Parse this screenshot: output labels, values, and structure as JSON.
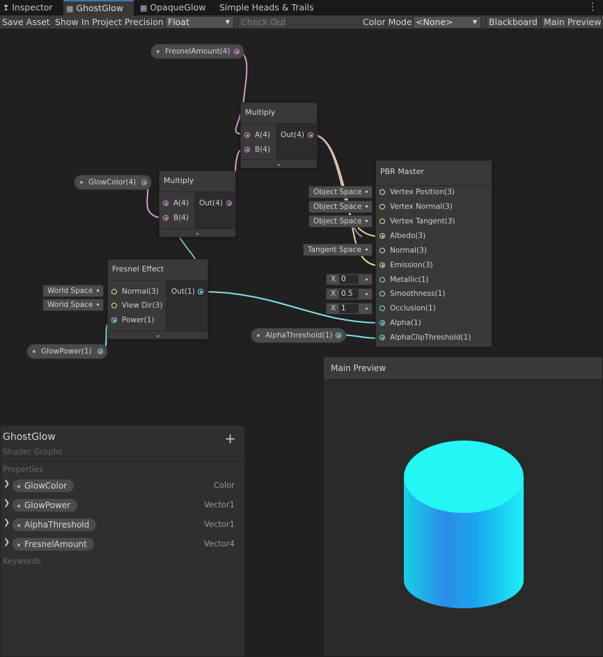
{
  "tabs": [
    {
      "label": "Inspector",
      "icon": "info-icon",
      "active": false
    },
    {
      "label": "GhostGlow",
      "icon": "shader-graph-icon",
      "active": true
    },
    {
      "label": "OpaqueGlow",
      "icon": "shader-graph-icon",
      "active": false
    },
    {
      "label": "Simple Heads & Trails",
      "icon": "",
      "active": false
    }
  ],
  "toolbar": {
    "save_asset": "Save Asset",
    "show_in_project": "Show In Project",
    "precision_label": "Precision",
    "precision_value": "Float",
    "check_out": "Check Out",
    "color_mode_label": "Color Mode",
    "color_mode_value": "<None>",
    "blackboard": "Blackboard",
    "main_preview": "Main Preview"
  },
  "properties_nodes": {
    "fresnel_amount": "FresnelAmount(4)",
    "glow_color": "GlowColor(4)",
    "glow_power": "GlowPower(1)",
    "alpha_threshold": "AlphaThreshold(1)"
  },
  "multiply_top": {
    "title": "Multiply",
    "in_a": "A(4)",
    "in_b": "B(4)",
    "out": "Out(4)"
  },
  "multiply_left": {
    "title": "Multiply",
    "in_a": "A(4)",
    "in_b": "B(4)",
    "out": "Out(4)"
  },
  "fresnel": {
    "title": "Fresnel Effect",
    "normal": "Normal(3)",
    "view_dir": "View Dir(3)",
    "power": "Power(1)",
    "out": "Out(1)",
    "normal_default": "World Space",
    "view_dir_default": "World Space"
  },
  "pbr_master": {
    "title": "PBR Master",
    "vertex_position": "Vertex Position(3)",
    "vertex_normal": "Vertex Normal(3)",
    "vertex_tangent": "Vertex Tangent(3)",
    "albedo": "Albedo(3)",
    "normal": "Normal(3)",
    "emission": "Emission(3)",
    "metallic": "Metallic(1)",
    "smoothness": "Smoothness(1)",
    "occlusion": "Occlusion(1)",
    "alpha": "Alpha(1)",
    "alpha_clip": "AlphaClipThreshold(1)",
    "vertex_position_default": "Object Space",
    "vertex_normal_default": "Object Space",
    "vertex_tangent_default": "Object Space",
    "normal_default": "Tangent Space",
    "x_label": "X",
    "metallic_value": "0",
    "smoothness_value": "0.5",
    "occlusion_value": "1"
  },
  "blackboard": {
    "title": "GhostGlow",
    "subtitle": "Shader Graphs",
    "properties_label": "Properties",
    "keywords_label": "Keywords",
    "properties": [
      {
        "name": "GlowColor",
        "type": "Color"
      },
      {
        "name": "GlowPower",
        "type": "Vector1"
      },
      {
        "name": "AlphaThreshold",
        "type": "Vector1"
      },
      {
        "name": "FresnelAmount",
        "type": "Vector4"
      }
    ]
  },
  "main_preview_panel": {
    "title": "Main Preview"
  },
  "colors": {
    "vector4_wire": "#d89bd7",
    "vector3_wire": "#e6e39c",
    "vector1_wire": "#84e4e7",
    "property_dot": "#7acc6e",
    "preview_cyan": "#22f4f4"
  }
}
